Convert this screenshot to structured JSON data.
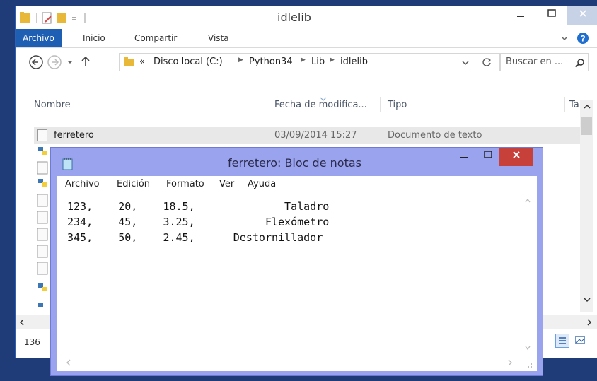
{
  "explorer": {
    "title": "idlelib",
    "ribbon_tabs": [
      "Archivo",
      "Inicio",
      "Compartir",
      "Vista"
    ],
    "address": {
      "prefix": "«",
      "crumbs": [
        "Disco local (C:)",
        "Python34",
        "Lib",
        "idlelib"
      ]
    },
    "search_placeholder": "Buscar en ...",
    "columns": {
      "name": "Nombre",
      "date": "Fecha de modifica...",
      "type": "Tipo",
      "size": "Ta"
    },
    "file": {
      "name": "ferretero",
      "date": "03/09/2014 15:27",
      "type": "Documento de texto"
    },
    "status_count": "136"
  },
  "notepad": {
    "title": "ferretero: Bloc de notas",
    "menu": [
      "Archivo",
      "Edición",
      "Formato",
      "Ver",
      "Ayuda"
    ],
    "lines": [
      "123,    20,    18.5,              Taladro",
      "234,    45,    3.25,           Flexómetro",
      "345,    50,    2.45,      Destornillador"
    ]
  }
}
